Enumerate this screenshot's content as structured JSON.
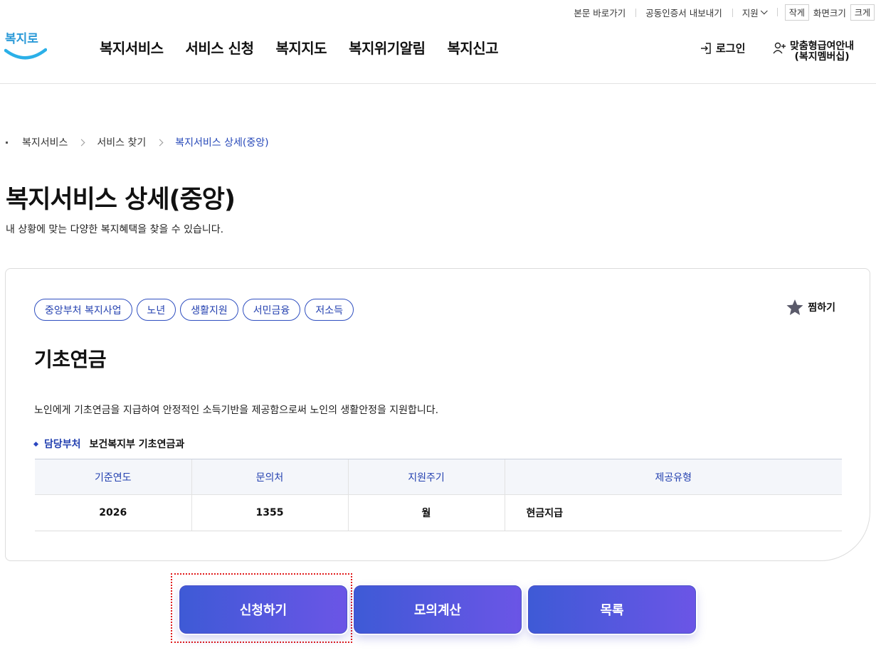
{
  "utility": {
    "skip_link": "본문 바로가기",
    "cert_export": "공동인증서 내보내기",
    "support": "지원",
    "zoom_small": "작게",
    "zoom_label": "화면크기",
    "zoom_large": "크게"
  },
  "logo": {
    "text": "복지로",
    "color": "#2b9ad8"
  },
  "nav": {
    "items": [
      "복지서비스",
      "서비스 신청",
      "복지지도",
      "복지위기알림",
      "복지신고"
    ]
  },
  "account": {
    "login": "로그인",
    "member_line1": "맞춤형급여안내",
    "member_line2": "(복지멤버십)"
  },
  "breadcrumb": {
    "items": [
      "복지서비스",
      "서비스 찾기",
      "복지서비스 상세(중앙)"
    ]
  },
  "page": {
    "title": "복지서비스 상세(중앙)",
    "subtitle": "내 상황에 맞는 다양한 복지혜택을 찾을 수 있습니다."
  },
  "service": {
    "tags": [
      "중앙부처 복지사업",
      "노년",
      "생활지원",
      "서민금융",
      "저소득"
    ],
    "favorite_label": "찜하기",
    "name": "기초연금",
    "description": "노인에게 기초연금을 지급하여 안정적인 소득기반을 제공함으로써 노인의 생활안정을 지원합니다.",
    "dept_label": "담당부처",
    "dept_value": "보건복지부 기초연금과",
    "table": {
      "headers": [
        "기준연도",
        "문의처",
        "지원주기",
        "제공유형"
      ],
      "row": [
        "2026",
        "1355",
        "월",
        "현금지급"
      ]
    }
  },
  "actions": {
    "apply": "신청하기",
    "simulate": "모의계산",
    "list": "목록"
  },
  "colors": {
    "accent": "#2441b0",
    "button_start": "#3e5ad6",
    "button_end": "#6b55e6",
    "focus_outline": "#e01b1b"
  }
}
